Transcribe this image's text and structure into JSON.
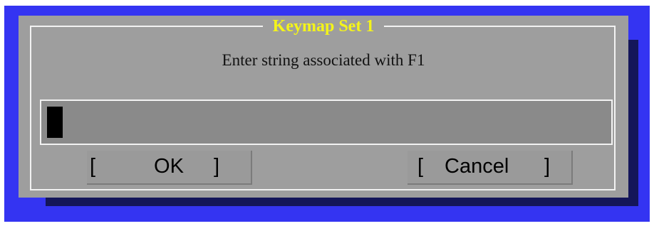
{
  "dialog": {
    "title": "Keymap Set 1",
    "prompt": "Enter string associated with F1",
    "input_value": ""
  },
  "buttons": {
    "ok": {
      "open": "[",
      "label": "OK",
      "close": "]"
    },
    "cancel": {
      "open": "[",
      "label": "Cancel",
      "close": "]"
    }
  },
  "colors": {
    "background": "#3434f2",
    "dialog": "#9e9e9e",
    "title": "#f4f419",
    "shadow": "#14165a"
  }
}
